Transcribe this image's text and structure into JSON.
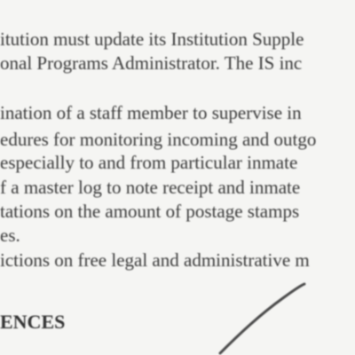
{
  "document": {
    "paragraph1": {
      "line1": "itution must update its Institution Supple",
      "line2": "onal Programs Administrator.  The IS inc"
    },
    "list": {
      "line1": "ination of a staff member to supervise in",
      "line2": "edures for monitoring incoming and outgo",
      "line3": "especially to and from particular inmate",
      "line4": "f a master log to note receipt and inmate",
      "line5": "tations on the amount of postage stamps",
      "line6": "es.",
      "line7": "ictions on free legal and administrative m"
    },
    "heading": "ENCES"
  }
}
